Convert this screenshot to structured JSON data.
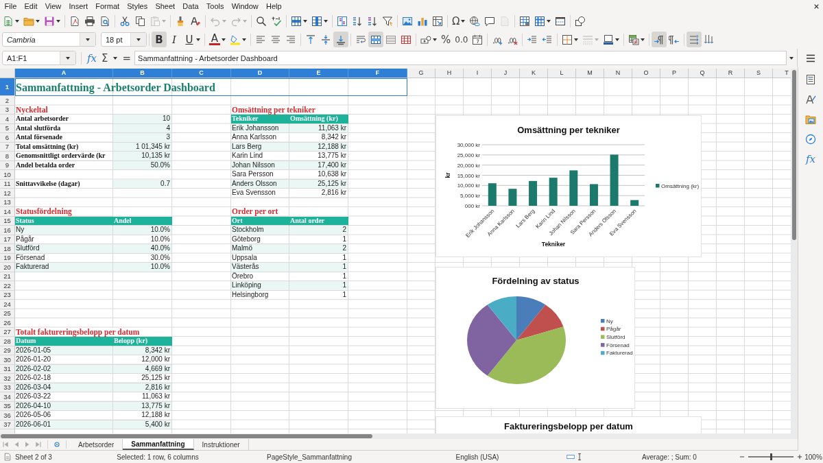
{
  "menu_bar": [
    "File",
    "Edit",
    "View",
    "Insert",
    "Format",
    "Styles",
    "Sheet",
    "Data",
    "Tools",
    "Window",
    "Help"
  ],
  "standard_toolbar": {
    "paste_disabled": true,
    "undo_disabled": true,
    "redo_disabled": true,
    "header_footer_disabled": true,
    "special_character": "Ω"
  },
  "format_toolbar": {
    "font_name": "Cambria",
    "font_size": "18 pt",
    "bold": {
      "label": "B",
      "on": true
    },
    "italic": {
      "label": "I",
      "on": false
    },
    "underline": {
      "label": "U",
      "on": false
    },
    "font_color_label": "A",
    "align_top": false,
    "align_middle": false,
    "align_bottom": true,
    "merge_center": true,
    "percent": "%",
    "number_format": "0.0",
    "border_style_disabled": true,
    "left_to_right": true,
    "right_to_left": false,
    "text_left_to_right": true,
    "text_top_to_bottom": false
  },
  "formula_bar": {
    "name_box": "A1:F1",
    "function_wizard": "fx",
    "sum": "Σ",
    "equals": "=",
    "content": "Sammanfattning - Arbetsorder Dashboard"
  },
  "sheet": {
    "columns": [
      {
        "label": "A",
        "selected": true
      },
      {
        "label": "B",
        "selected": true
      },
      {
        "label": "C",
        "selected": true
      },
      {
        "label": "D",
        "selected": true
      },
      {
        "label": "E",
        "selected": true
      },
      {
        "label": "F",
        "selected": true
      },
      {
        "label": "G",
        "selected": false
      },
      {
        "label": "H",
        "selected": false
      },
      {
        "label": "I",
        "selected": false
      },
      {
        "label": "J",
        "selected": false
      },
      {
        "label": "K",
        "selected": false
      },
      {
        "label": "L",
        "selected": false
      },
      {
        "label": "M",
        "selected": false
      },
      {
        "label": "N",
        "selected": false
      },
      {
        "label": "O",
        "selected": false
      },
      {
        "label": "P",
        "selected": false
      },
      {
        "label": "Q",
        "selected": false
      },
      {
        "label": "R",
        "selected": false
      },
      {
        "label": "S",
        "selected": false
      },
      {
        "label": "T",
        "selected": false
      }
    ],
    "rows": [
      {
        "number": "1",
        "selected": true,
        "cells": {
          "A": {
            "kind": "title",
            "text": "Sammanfattning - Arbetsorder Dashboard",
            "shaded": false,
            "selected": true
          }
        }
      },
      {
        "number": "2",
        "selected": false
      },
      {
        "number": "3",
        "selected": false,
        "cells": {
          "A": {
            "kind": "section",
            "text": "Nyckeltal",
            "shaded": false,
            "selected": false
          },
          "D": {
            "kind": "section",
            "text": "Omsättning per tekniker",
            "shaded": false,
            "selected": false
          }
        }
      },
      {
        "number": "4",
        "selected": false,
        "cells": {
          "A": {
            "kind": "label",
            "text": "Antal arbetsorder",
            "shaded": false,
            "selected": false
          },
          "B": {
            "kind": "number",
            "text": "10",
            "shaded": true,
            "selected": false
          },
          "D": {
            "kind": "header",
            "text": "Tekniker",
            "selected": false
          },
          "E": {
            "kind": "header",
            "text": "Omsättning (kr)",
            "selected": false
          }
        }
      },
      {
        "number": "5",
        "selected": false,
        "cells": {
          "A": {
            "kind": "label",
            "text": "Antal slutförda",
            "shaded": false,
            "selected": false
          },
          "B": {
            "kind": "number",
            "text": "4",
            "shaded": true,
            "selected": false
          },
          "D": {
            "kind": "text",
            "text": "Erik Johansson",
            "shaded": true,
            "selected": false
          },
          "E": {
            "kind": "number",
            "text": "11,063 kr",
            "shaded": true,
            "selected": false
          }
        }
      },
      {
        "number": "6",
        "selected": false,
        "cells": {
          "A": {
            "kind": "label",
            "text": "Antal försenade",
            "shaded": false,
            "selected": false
          },
          "B": {
            "kind": "number",
            "text": "3",
            "shaded": true,
            "selected": false
          },
          "D": {
            "kind": "text",
            "text": "Anna Karlsson",
            "shaded": false,
            "selected": false
          },
          "E": {
            "kind": "number",
            "text": "8,342 kr",
            "shaded": false,
            "selected": false
          }
        }
      },
      {
        "number": "7",
        "selected": false,
        "cells": {
          "A": {
            "kind": "label",
            "text": "Total omsättning (kr)",
            "shaded": false,
            "selected": false
          },
          "B": {
            "kind": "number",
            "text": "1 01,345 kr",
            "shaded": true,
            "selected": false
          },
          "D": {
            "kind": "text",
            "text": "Lars Berg",
            "shaded": true,
            "selected": false
          },
          "E": {
            "kind": "number",
            "text": "12,188 kr",
            "shaded": true,
            "selected": false
          }
        }
      },
      {
        "number": "8",
        "selected": false,
        "cells": {
          "A": {
            "kind": "label",
            "text": "Genomsnittligt ordervärde (kr",
            "shaded": false,
            "selected": false
          },
          "B": {
            "kind": "number",
            "text": "10,135 kr",
            "shaded": true,
            "selected": false
          },
          "D": {
            "kind": "text",
            "text": "Karin Lind",
            "shaded": false,
            "selected": false
          },
          "E": {
            "kind": "number",
            "text": "13,775 kr",
            "shaded": false,
            "selected": false
          }
        }
      },
      {
        "number": "9",
        "selected": false,
        "cells": {
          "A": {
            "kind": "label",
            "text": "Andel betalda order",
            "shaded": false,
            "selected": false
          },
          "B": {
            "kind": "number",
            "text": "50.0%",
            "shaded": true,
            "selected": false
          },
          "D": {
            "kind": "text",
            "text": "Johan Nilsson",
            "shaded": true,
            "selected": false
          },
          "E": {
            "kind": "number",
            "text": "17,400 kr",
            "shaded": true,
            "selected": false
          }
        }
      },
      {
        "number": "10",
        "selected": false,
        "cells": {
          "D": {
            "kind": "text",
            "text": "Sara Persson",
            "shaded": false,
            "selected": false
          },
          "E": {
            "kind": "number",
            "text": "10,638 kr",
            "shaded": false,
            "selected": false
          }
        }
      },
      {
        "number": "11",
        "selected": false,
        "cells": {
          "A": {
            "kind": "label",
            "text": "Snittavvikelse (dagar)",
            "shaded": false,
            "selected": false
          },
          "B": {
            "kind": "number",
            "text": "0.7",
            "shaded": true,
            "selected": false
          },
          "D": {
            "kind": "text",
            "text": "Anders Olsson",
            "shaded": true,
            "selected": false
          },
          "E": {
            "kind": "number",
            "text": "25,125 kr",
            "shaded": true,
            "selected": false
          }
        }
      },
      {
        "number": "12",
        "selected": false,
        "cells": {
          "D": {
            "kind": "text",
            "text": "Eva Svensson",
            "shaded": false,
            "selected": false
          },
          "E": {
            "kind": "number",
            "text": "2,816 kr",
            "shaded": false,
            "selected": false
          }
        }
      },
      {
        "number": "13",
        "selected": false
      },
      {
        "number": "14",
        "selected": false,
        "cells": {
          "A": {
            "kind": "section",
            "text": "Statusfördelning",
            "shaded": false,
            "selected": false
          },
          "D": {
            "kind": "section",
            "text": "Order per ort",
            "shaded": false,
            "selected": false
          }
        }
      },
      {
        "number": "15",
        "selected": false,
        "cells": {
          "A": {
            "kind": "header",
            "text": "Status",
            "selected": false
          },
          "B": {
            "kind": "header",
            "text": "Andel",
            "selected": false
          },
          "D": {
            "kind": "header",
            "text": "Ort",
            "selected": false
          },
          "E": {
            "kind": "header",
            "text": "Antal order",
            "selected": false
          }
        }
      },
      {
        "number": "16",
        "selected": false,
        "cells": {
          "A": {
            "kind": "text",
            "text": "Ny",
            "shaded": true,
            "selected": false
          },
          "B": {
            "kind": "number",
            "text": "10.0%",
            "shaded": true,
            "selected": false
          },
          "D": {
            "kind": "text",
            "text": "Stockholm",
            "shaded": true,
            "selected": false
          },
          "E": {
            "kind": "number",
            "text": "2",
            "shaded": true,
            "selected": false
          }
        }
      },
      {
        "number": "17",
        "selected": false,
        "cells": {
          "A": {
            "kind": "text",
            "text": "Pågår",
            "shaded": false,
            "selected": false
          },
          "B": {
            "kind": "number",
            "text": "10.0%",
            "shaded": false,
            "selected": false
          },
          "D": {
            "kind": "text",
            "text": "Göteborg",
            "shaded": false,
            "selected": false
          },
          "E": {
            "kind": "number",
            "text": "1",
            "shaded": false,
            "selected": false
          }
        }
      },
      {
        "number": "18",
        "selected": false,
        "cells": {
          "A": {
            "kind": "text",
            "text": "Slutförd",
            "shaded": true,
            "selected": false
          },
          "B": {
            "kind": "number",
            "text": "40.0%",
            "shaded": true,
            "selected": false
          },
          "D": {
            "kind": "text",
            "text": "Malmö",
            "shaded": true,
            "selected": false
          },
          "E": {
            "kind": "number",
            "text": "2",
            "shaded": true,
            "selected": false
          }
        }
      },
      {
        "number": "19",
        "selected": false,
        "cells": {
          "A": {
            "kind": "text",
            "text": "Försenad",
            "shaded": false,
            "selected": false
          },
          "B": {
            "kind": "number",
            "text": "30.0%",
            "shaded": false,
            "selected": false
          },
          "D": {
            "kind": "text",
            "text": "Uppsala",
            "shaded": false,
            "selected": false
          },
          "E": {
            "kind": "number",
            "text": "1",
            "shaded": false,
            "selected": false
          }
        }
      },
      {
        "number": "20",
        "selected": false,
        "cells": {
          "A": {
            "kind": "text",
            "text": "Fakturerad",
            "shaded": true,
            "selected": false
          },
          "B": {
            "kind": "number",
            "text": "10.0%",
            "shaded": true,
            "selected": false
          },
          "D": {
            "kind": "text",
            "text": "Västerås",
            "shaded": true,
            "selected": false
          },
          "E": {
            "kind": "number",
            "text": "1",
            "shaded": true,
            "selected": false
          }
        }
      },
      {
        "number": "21",
        "selected": false,
        "cells": {
          "D": {
            "kind": "text",
            "text": "Örebro",
            "shaded": false,
            "selected": false
          },
          "E": {
            "kind": "number",
            "text": "1",
            "shaded": false,
            "selected": false
          }
        }
      },
      {
        "number": "22",
        "selected": false,
        "cells": {
          "D": {
            "kind": "text",
            "text": "Linköping",
            "shaded": true,
            "selected": false
          },
          "E": {
            "kind": "number",
            "text": "1",
            "shaded": true,
            "selected": false
          }
        }
      },
      {
        "number": "23",
        "selected": false,
        "cells": {
          "D": {
            "kind": "text",
            "text": "Helsingborg",
            "shaded": false,
            "selected": false
          },
          "E": {
            "kind": "number",
            "text": "1",
            "shaded": false,
            "selected": false
          }
        }
      },
      {
        "number": "24",
        "selected": false
      },
      {
        "number": "25",
        "selected": false
      },
      {
        "number": "26",
        "selected": false
      },
      {
        "number": "27",
        "selected": false,
        "cells": {
          "A": {
            "kind": "section",
            "text": "Totalt faktureringsbelopp per datum",
            "shaded": false,
            "selected": false
          }
        }
      },
      {
        "number": "28",
        "selected": false,
        "cells": {
          "A": {
            "kind": "header",
            "text": "Datum",
            "selected": false
          },
          "B": {
            "kind": "header",
            "text": "Belopp (kr)",
            "selected": false
          }
        }
      },
      {
        "number": "29",
        "selected": false,
        "cells": {
          "A": {
            "kind": "text",
            "text": "2026-01-05",
            "shaded": true,
            "selected": false
          },
          "B": {
            "kind": "number",
            "text": "8,342 kr",
            "shaded": true,
            "selected": false
          }
        }
      },
      {
        "number": "30",
        "selected": false,
        "cells": {
          "A": {
            "kind": "text",
            "text": "2026-01-20",
            "shaded": false,
            "selected": false
          },
          "B": {
            "kind": "number",
            "text": "12,000 kr",
            "shaded": false,
            "selected": false
          }
        }
      },
      {
        "number": "31",
        "selected": false,
        "cells": {
          "A": {
            "kind": "text",
            "text": "2026-02-02",
            "shaded": true,
            "selected": false
          },
          "B": {
            "kind": "number",
            "text": "4,669 kr",
            "shaded": true,
            "selected": false
          }
        }
      },
      {
        "number": "32",
        "selected": false,
        "cells": {
          "A": {
            "kind": "text",
            "text": "2026-02-18",
            "shaded": false,
            "selected": false
          },
          "B": {
            "kind": "number",
            "text": "25,125 kr",
            "shaded": false,
            "selected": false
          }
        }
      },
      {
        "number": "33",
        "selected": false,
        "cells": {
          "A": {
            "kind": "text",
            "text": "2026-03-04",
            "shaded": true,
            "selected": false
          },
          "B": {
            "kind": "number",
            "text": "2,816 kr",
            "shaded": true,
            "selected": false
          }
        }
      },
      {
        "number": "34",
        "selected": false,
        "cells": {
          "A": {
            "kind": "text",
            "text": "2026-03-22",
            "shaded": false,
            "selected": false
          },
          "B": {
            "kind": "number",
            "text": "11,063 kr",
            "shaded": false,
            "selected": false
          }
        }
      },
      {
        "number": "35",
        "selected": false,
        "cells": {
          "A": {
            "kind": "text",
            "text": "2026-04-10",
            "shaded": true,
            "selected": false
          },
          "B": {
            "kind": "number",
            "text": "13,775 kr",
            "shaded": true,
            "selected": false
          }
        }
      },
      {
        "number": "36",
        "selected": false,
        "cells": {
          "A": {
            "kind": "text",
            "text": "2026-05-06",
            "shaded": false,
            "selected": false
          },
          "B": {
            "kind": "number",
            "text": "12,188 kr",
            "shaded": false,
            "selected": false
          }
        }
      },
      {
        "number": "37",
        "selected": false,
        "cells": {
          "A": {
            "kind": "text",
            "text": "2026-06-01",
            "shaded": true,
            "selected": false
          },
          "B": {
            "kind": "number",
            "text": "5,400 kr",
            "shaded": true,
            "selected": false
          }
        }
      }
    ]
  },
  "charts": [
    {
      "chart_data": {
        "type": "bar",
        "title": "Omsättning per tekniker",
        "xlabel": "Tekniker",
        "ylabel": "kr",
        "categories": [
          "Erik Johansson",
          "Anna Karlsson",
          "Lars Berg",
          "Karin Lind",
          "Johan Nilsson",
          "Sara Persson",
          "Anders Olsson",
          "Eva Svensson"
        ],
        "series": [
          {
            "name": "Omsättning (kr)",
            "color": "#1b7a6c",
            "values": [
              11063,
              8342,
              12188,
              13775,
              17400,
              10638,
              25125,
              2816
            ]
          }
        ],
        "ylim": [
          0,
          30000
        ],
        "yticks": [
          {
            "value": 0,
            "label": "000 kr"
          },
          {
            "value": 5000,
            "label": "5,000 kr"
          },
          {
            "value": 10000,
            "label": "10,000 kr"
          },
          {
            "value": 15000,
            "label": "15,000 kr"
          },
          {
            "value": 20000,
            "label": "20,000 kr"
          },
          {
            "value": 25000,
            "label": "25,000 kr"
          },
          {
            "value": 30000,
            "label": "30,000 kr"
          }
        ],
        "grid": true,
        "legend": "right"
      }
    },
    {
      "chart_data": {
        "type": "pie",
        "title": "Fördelning av status",
        "categories": [
          "Ny",
          "Pågår",
          "Slutförd",
          "Försenad",
          "Fakturerad"
        ],
        "values": [
          10,
          10,
          40,
          30,
          10
        ],
        "colors": [
          "#4a7ebb",
          "#c0504d",
          "#9bbb59",
          "#8064a2",
          "#4bacc6"
        ],
        "legend": "right"
      }
    },
    {
      "title": "Faktureringsbelopp per datum"
    }
  ],
  "sidebar": {
    "functions": "fx"
  },
  "sheet_tabs": [
    {
      "label": "Arbetsorder",
      "selected": false
    },
    {
      "label": "Sammanfattning",
      "selected": true
    },
    {
      "label": "Instruktioner",
      "selected": false
    }
  ],
  "status_bar": {
    "sheet": "Sheet 2 of 3",
    "selection": "Selected: 1 row, 6 columns",
    "page_style": "PageStyle_Sammanfattning",
    "language": "English (USA)",
    "summary": "Average: ; Sum: 0",
    "zoom": {
      "level": 0.5
    },
    "zoom_percent": "100%"
  }
}
